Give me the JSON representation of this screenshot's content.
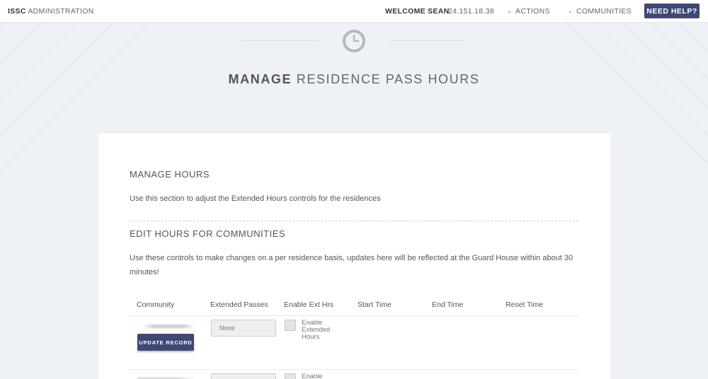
{
  "topbar": {
    "brand_bold": "ISSC",
    "brand_rest": " ADMINISTRATION",
    "welcome": "WELCOME SEAN",
    "ip": "24.151.18.38",
    "actions_label": "ACTIONS",
    "communities_label": "COMMUNITIES",
    "help_label": "NEED HELP?"
  },
  "hero": {
    "icon": "clock-icon",
    "title_bold": "MANAGE",
    "title_rest": " RESIDENCE PASS HOURS"
  },
  "manage": {
    "heading": "MANAGE HOURS",
    "description": "Use this section to adjust the Extended Hours controls for the residences"
  },
  "edit": {
    "heading": "EDIT HOURS FOR COMMUNITIES",
    "description": "Use these controls to make changes on a per residence basis, updates here will be reflected at the Guard House within about 30 minutes!"
  },
  "table": {
    "headers": [
      "Community",
      "Extended Passes",
      "Enable Ext Hrs",
      "Start Time",
      "End Time",
      "Reset Time"
    ],
    "rows": [
      {
        "update_label": "UPDATE RECORD",
        "extended_passes": "None",
        "enable_label": "Enable Extended Hours",
        "enable_label_lines": [
          "Enable",
          "Extended",
          "Hours"
        ]
      },
      {
        "enable_label_lines": [
          "Enable"
        ]
      }
    ]
  },
  "colors": {
    "accent": "#3f4774",
    "background": "#eef1f6",
    "card": "#ffffff"
  }
}
